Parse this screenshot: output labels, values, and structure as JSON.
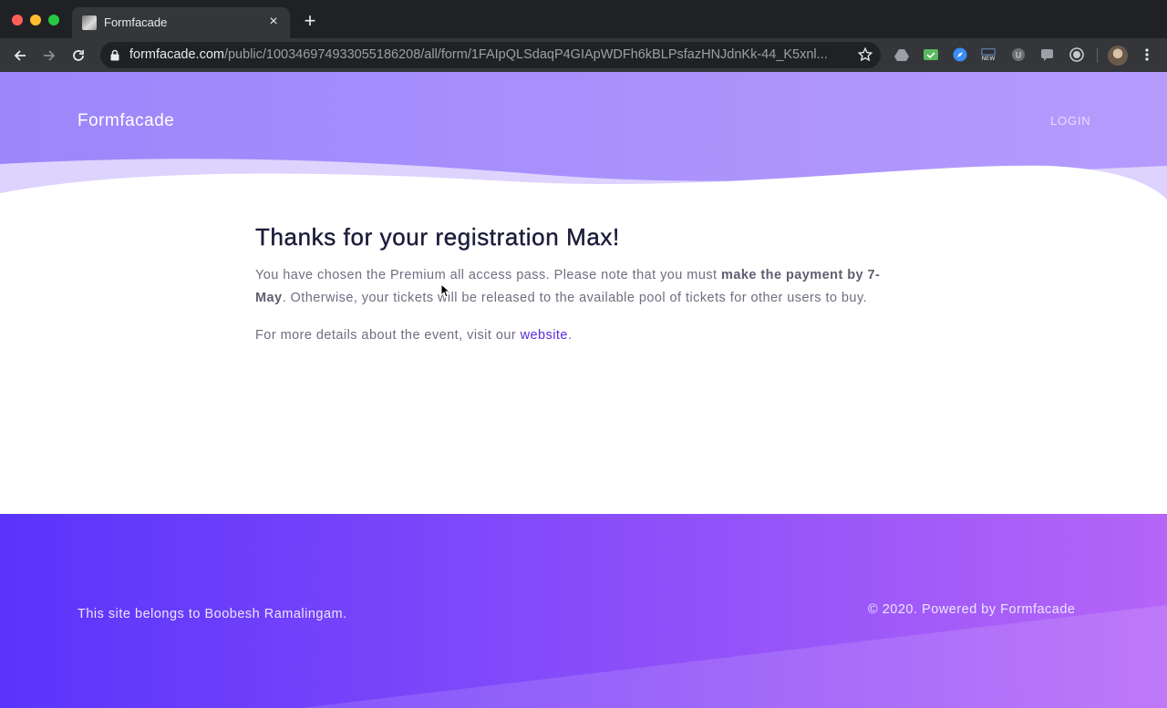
{
  "browser": {
    "tab_title": "Formfacade",
    "tab_close": "×",
    "new_tab": "+",
    "url_host": "formfacade.com",
    "url_path": "/public/100346974933055186208/all/form/1FAIpQLSdaqP4GIApWDFh6kBLPsfazHNJdnKk-44_K5xnl..."
  },
  "header": {
    "brand": "Formfacade",
    "login": "LOGIN"
  },
  "main": {
    "heading": "Thanks for your registration Max!",
    "para1_before": "You have chosen the Premium all access pass. Please note that you must ",
    "para1_bold": "make the payment by 7-May",
    "para1_after": ". Otherwise, your tickets will be released to the available pool of tickets for other users to buy.",
    "para2_before": "For more details about the event, visit our ",
    "para2_link": "website",
    "para2_after": "."
  },
  "footer": {
    "owner_text": "This site belongs to Boobesh Ramalingam.",
    "powered_text": "© 2020. Powered by Formfacade"
  },
  "colors": {
    "hero_start": "#9b86fb",
    "hero_end": "#b69bfd",
    "footer_start": "#5a34fb",
    "footer_end": "#b565f8",
    "link": "#5b2be0"
  },
  "icons": {
    "back": "arrow-left-icon",
    "forward": "arrow-right-icon",
    "reload": "reload-icon",
    "lock": "lock-icon",
    "bookmark": "star-icon",
    "menu": "kebab-menu-icon"
  }
}
